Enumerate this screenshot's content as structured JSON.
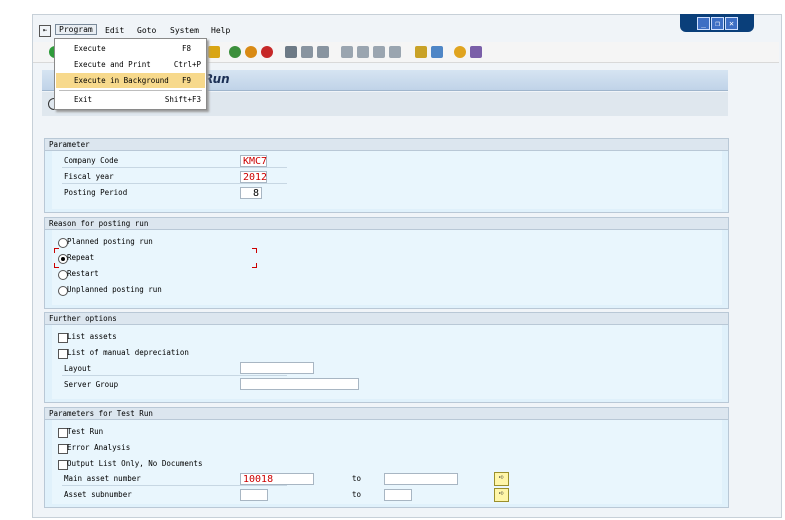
{
  "menubar": {
    "items": [
      {
        "label": "Program"
      },
      {
        "label": "Edit"
      },
      {
        "label": "Goto"
      },
      {
        "label": "System"
      },
      {
        "label": "Help"
      }
    ]
  },
  "program_menu": {
    "items": [
      {
        "label": "Execute",
        "shortcut": "F8"
      },
      {
        "label": "Execute and Print",
        "shortcut": "Ctrl+P"
      },
      {
        "label": "Execute in Background",
        "shortcut": "F9"
      },
      {
        "label": "Exit",
        "shortcut": "Shift+F3"
      }
    ]
  },
  "window_title": "Run",
  "parameter": {
    "title": "Parameter",
    "company_code_label": "Company Code",
    "company_code": "KMC7",
    "fiscal_year_label": "Fiscal year",
    "fiscal_year": "2012",
    "posting_period_label": "Posting Period",
    "posting_period": "8"
  },
  "reason": {
    "title": "Reason for posting run",
    "options": [
      {
        "label": "Planned posting run",
        "selected": false
      },
      {
        "label": "Repeat",
        "selected": true
      },
      {
        "label": "Restart",
        "selected": false
      },
      {
        "label": "Unplanned posting run",
        "selected": false
      }
    ]
  },
  "further": {
    "title": "Further options",
    "list_assets_label": "List assets",
    "list_manual_dep_label": "List of manual depreciation",
    "layout_label": "Layout",
    "layout_value": "",
    "server_group_label": "Server Group",
    "server_group_value": ""
  },
  "test_run": {
    "title": "Parameters for Test Run",
    "test_run_label": "Test Run",
    "error_analysis_label": "Error Analysis",
    "output_list_label": "Output List Only, No Documents",
    "main_asset_label": "Main asset number",
    "main_asset_from": "10018",
    "main_asset_to": "",
    "asset_sub_label": "Asset subnumber",
    "asset_sub_from": "",
    "asset_sub_to": "",
    "to_label": "to"
  },
  "colors": {
    "accent": "#0a3f7a",
    "highlight": "#f7d98c",
    "group_bg": "#e0f1fb",
    "value_red": "#cc0000"
  }
}
